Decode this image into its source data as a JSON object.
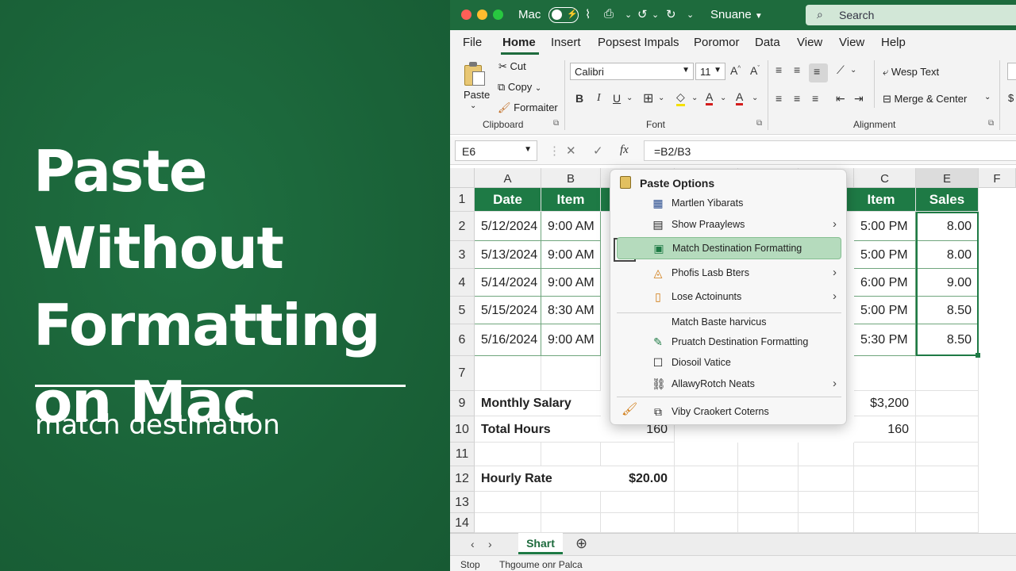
{
  "promo": {
    "title_line1": "Paste Without",
    "title_line2": "Formatting",
    "title_line3": "on Mac",
    "subtitle": "match destination"
  },
  "titlebar": {
    "app_name": "Mac",
    "username": "Snuane",
    "search_placeholder": "Search"
  },
  "tabs": [
    "File",
    "Home",
    "Insert",
    "Popsest Impals",
    "Poromor",
    "Data",
    "View",
    "View",
    "Help"
  ],
  "ribbon": {
    "paste_label": "Paste",
    "cut_label": "Cut",
    "copy_label": "Copy",
    "formatter_label": "Formaiter",
    "clipboard_group": "Clipboard",
    "font_name": "Calibri",
    "font_size": "11",
    "font_group": "Font",
    "bold": "B",
    "italic": "I",
    "underline": "U",
    "wrap_text": "Wesp Text",
    "merge_center": "Merge & Center",
    "alignment_group": "Alignment"
  },
  "formula_bar": {
    "cell_ref": "E6",
    "fx": "fx",
    "formula": "=B2/B3"
  },
  "grid": {
    "col_headers": [
      "A",
      "B",
      "C",
      "E",
      "F"
    ],
    "row_headers": [
      "1",
      "2",
      "3",
      "4",
      "5",
      "6",
      "7",
      "9",
      "10",
      "11",
      "12",
      "13",
      "14"
    ],
    "table_headers": [
      "Date",
      "Item",
      "Item",
      "Sales"
    ],
    "table_rows": [
      [
        "5/12/2024",
        "9:00 AM",
        "5:00 PM",
        "8.00"
      ],
      [
        "5/13/2024",
        "9:00 AM",
        "5:00 PM",
        "8.00"
      ],
      [
        "5/14/2024",
        "9:00 AM",
        "6:00 PM",
        "9.00"
      ],
      [
        "5/15/2024",
        "8:30 AM",
        "5:00 PM",
        "8.50"
      ],
      [
        "5/16/2024",
        "9:00 AM",
        "5:30 PM",
        "8.50"
      ]
    ],
    "monthly_salary_label": "Monthly Salary",
    "monthly_salary_value": "$3,200",
    "total_hours_label": "Total Hours",
    "total_hours_b": "160",
    "total_hours_c": "160",
    "hourly_rate_label": "Hourly Rate",
    "hourly_rate_value": "$20.00"
  },
  "menu": {
    "title": "Paste Options",
    "items": [
      "Martlen Yibarats",
      "Show Praaylews",
      "Match Destination Formatting",
      "Phofis Lasb Bters",
      "Lose Actoinunts",
      "Match Baste harvicus",
      "Pruatch Destination Formatting",
      "Diosoil Vatice",
      "AllawyRotch Neats",
      "Viby Craokert Coterns"
    ]
  },
  "sheetbar": {
    "sheet_name": "Shart"
  },
  "statusbar": {
    "left": "Stop",
    "text": "Thgoume onr Palca"
  }
}
